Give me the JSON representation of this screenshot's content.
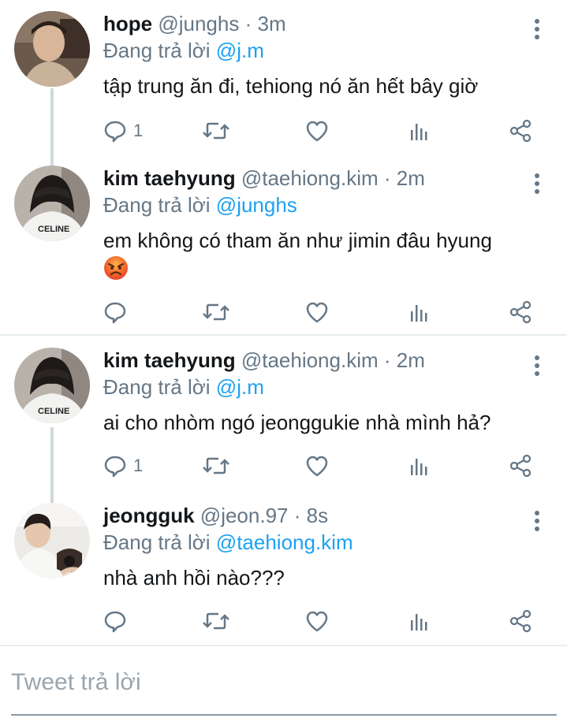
{
  "tweets": [
    {
      "name": "hope",
      "handle": "@junghs",
      "time": "3m",
      "replying_prefix": "Đang trả lời",
      "replying_to": "@j.m",
      "text": "tập trung ăn đi, tehiong nó ăn hết bây giờ",
      "reply_count": "1"
    },
    {
      "name": "kim taehyung",
      "handle": "@taehiong.kim",
      "time": "2m",
      "replying_prefix": "Đang trả lời",
      "replying_to": "@junghs",
      "text": "em không có tham ăn như jimin đâu hyung",
      "emoji": "angry-face",
      "reply_count": ""
    },
    {
      "name": "kim taehyung",
      "handle": "@taehiong.kim",
      "time": "2m",
      "replying_prefix": "Đang trả lời",
      "replying_to": "@j.m",
      "text": "ai cho nhòm ngó jeonggukie nhà mình hả?",
      "reply_count": "1"
    },
    {
      "name": "jeongguk",
      "handle": "@jeon.97",
      "time": "8s",
      "replying_prefix": "Đang trả lời",
      "replying_to": "@taehiong.kim",
      "text": "nhà anh hồi nào???",
      "reply_count": ""
    }
  ],
  "separator": "·",
  "reply_box": {
    "placeholder": "Tweet trả lời"
  },
  "icons": {
    "reply": "reply-icon",
    "retweet": "retweet-icon",
    "like": "heart-icon",
    "analytics": "analytics-icon",
    "share": "share-icon",
    "more": "more-vertical-icon"
  },
  "colors": {
    "mention": "#1da1f2",
    "secondary": "#657786",
    "thread_line": "#cfd9de"
  }
}
